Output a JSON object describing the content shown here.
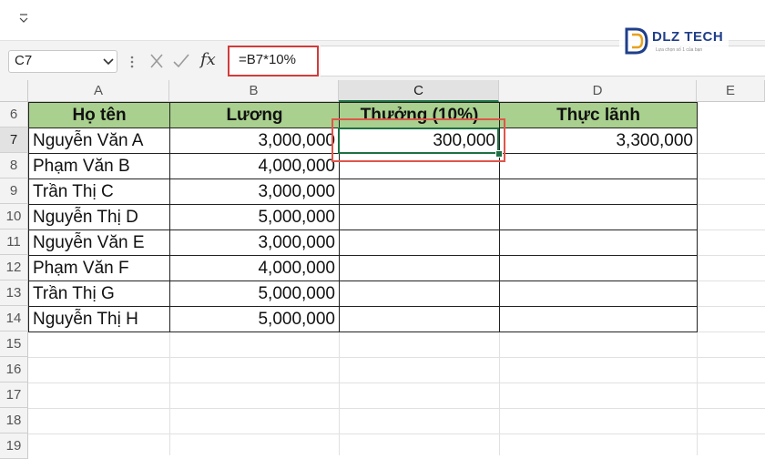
{
  "formula_bar": {
    "name_box": "C7",
    "fx_label": "fx",
    "formula": "=B7*10%"
  },
  "logo": {
    "brand": "DLZ TECH",
    "tagline": "Lựa chọn số 1 của bạn"
  },
  "columns": [
    "A",
    "B",
    "C",
    "D",
    "E"
  ],
  "rows": [
    "6",
    "7",
    "8",
    "9",
    "10",
    "11",
    "12",
    "13",
    "14",
    "15",
    "16",
    "17",
    "18",
    "19"
  ],
  "table": {
    "headers": [
      "Họ tên",
      "Lương",
      "Thưởng (10%)",
      "Thực lãnh"
    ],
    "records": [
      {
        "name": "Nguyễn Văn A",
        "salary": "3,000,000",
        "bonus": "300,000",
        "net": "3,300,000"
      },
      {
        "name": "Phạm Văn B",
        "salary": "4,000,000",
        "bonus": "",
        "net": ""
      },
      {
        "name": "Trần Thị C",
        "salary": "3,000,000",
        "bonus": "",
        "net": ""
      },
      {
        "name": "Nguyễn Thị D",
        "salary": "5,000,000",
        "bonus": "",
        "net": ""
      },
      {
        "name": "Nguyễn Văn E",
        "salary": "3,000,000",
        "bonus": "",
        "net": ""
      },
      {
        "name": "Phạm Văn F",
        "salary": "4,000,000",
        "bonus": "",
        "net": ""
      },
      {
        "name": "Trần Thị G",
        "salary": "5,000,000",
        "bonus": "",
        "net": ""
      },
      {
        "name": "Nguyễn Thị H",
        "salary": "5,000,000",
        "bonus": "",
        "net": ""
      }
    ]
  },
  "colors": {
    "header_fill": "#a9d08e",
    "selection_green": "#1e7145",
    "highlight_red": "#e0554a"
  }
}
